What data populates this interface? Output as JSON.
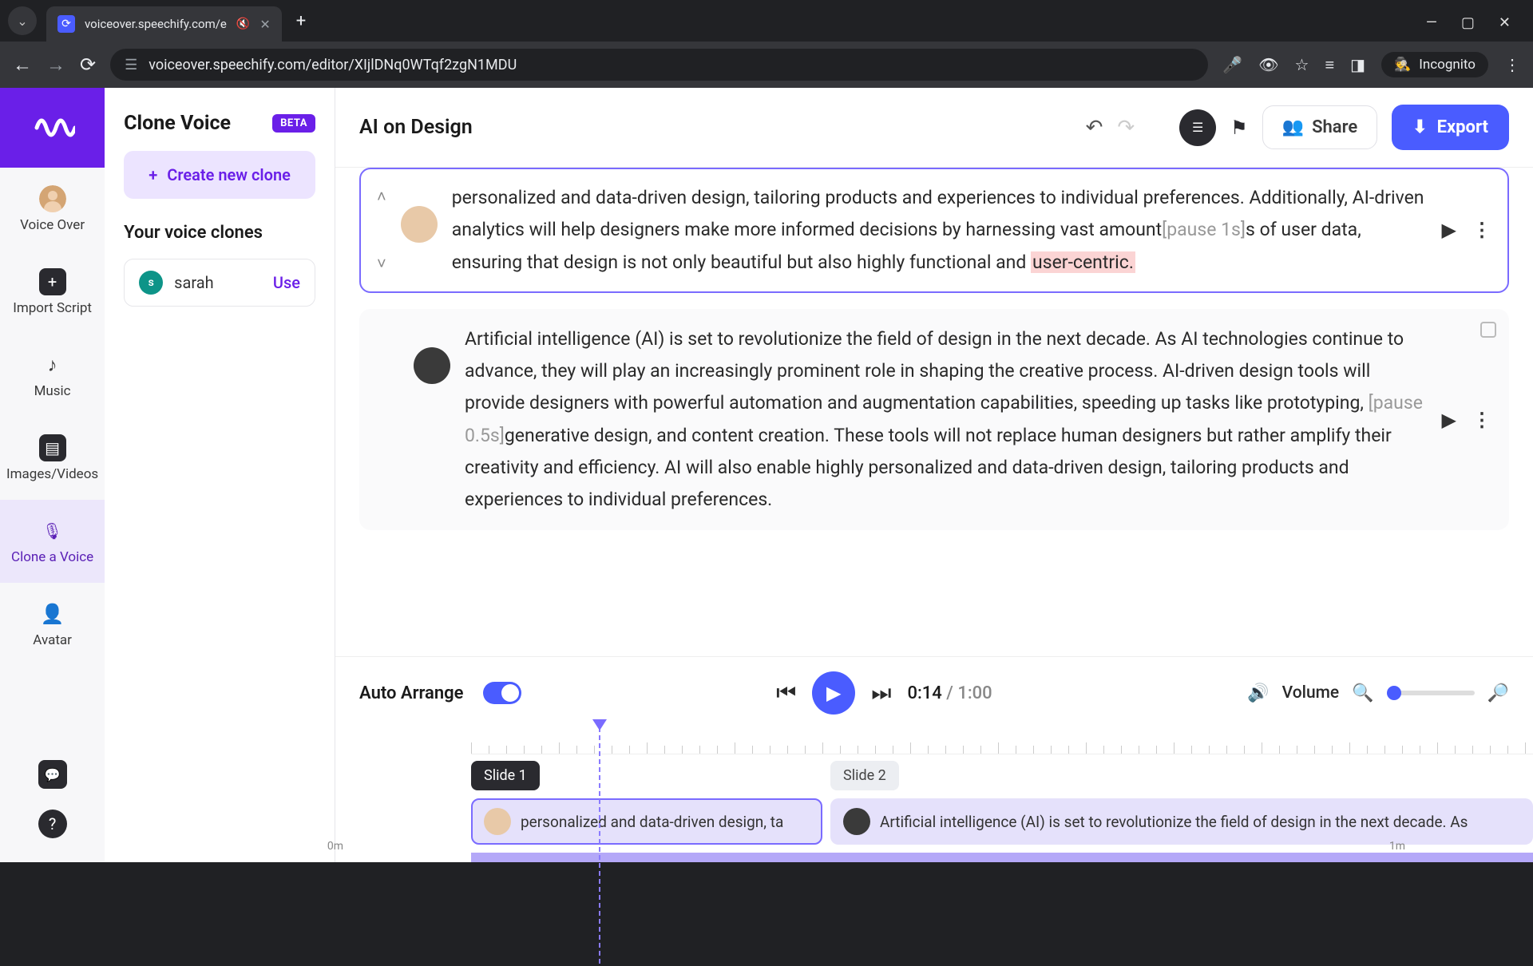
{
  "browser": {
    "tab_title": "voiceover.speechify.com/e",
    "url": "voiceover.speechify.com/editor/XIjlDNq0WTqf2zgN1MDU",
    "incognito_label": "Incognito"
  },
  "left_rail": {
    "items": [
      {
        "label": "Voice Over"
      },
      {
        "label": "Import Script"
      },
      {
        "label": "Music"
      },
      {
        "label": "Images/Videos"
      },
      {
        "label": "Clone a Voice"
      },
      {
        "label": "Avatar"
      }
    ]
  },
  "side_panel": {
    "title": "Clone Voice",
    "badge": "BETA",
    "create_btn": "Create new clone",
    "your_clones_title": "Your voice clones",
    "clones": [
      {
        "initial": "s",
        "name": "sarah",
        "action": "Use"
      }
    ]
  },
  "header": {
    "doc_title": "AI on Design",
    "share_label": "Share",
    "export_label": "Export"
  },
  "blocks": {
    "b1": {
      "text_pre": "personalized and data-driven design, tailoring products and experiences to individual preferences. Additionally, AI-driven analytics will help designers make more informed decisions by harnessing vast amount",
      "pause": "[pause 1s]",
      "text_mid": "s of user data, ensuring that design is not only beautiful but also highly functional and ",
      "highlight": "user-centric."
    },
    "b2": {
      "text_pre": "Artificial intelligence (AI) is set to revolutionize the field of design in the next decade. As AI technologies continue to advance, they will play an increasingly prominent role in shaping the creative process. AI-driven design tools will provide designers with powerful automation and augmentation capabilities, speeding up tasks like prototyping, ",
      "pause": "[pause 0.5s]",
      "text_post": "generative design, and content creation. These tools will not replace human designers but rather amplify their creativity and efficiency. AI will also enable highly personalized and data-driven design, tailoring products and experiences to individual preferences."
    }
  },
  "timeline": {
    "auto_arrange_label": "Auto Arrange",
    "current_time": "0:14",
    "total_time": "1:00",
    "volume_label": "Volume",
    "marker_0": "0m",
    "marker_1": "1m",
    "slide1_label": "Slide 1",
    "slide2_label": "Slide 2",
    "clip1_text": "personalized and data-driven design, ta",
    "clip2_text": "Artificial intelligence (AI) is set to revolutionize the field of design in the next decade. As"
  }
}
